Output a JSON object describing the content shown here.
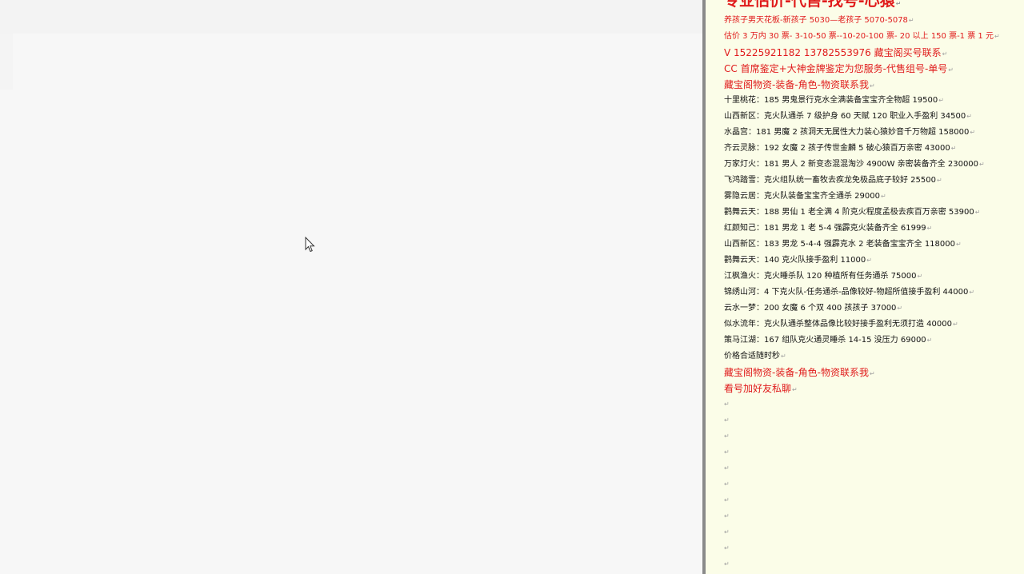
{
  "document": {
    "heading": "专业估价-代售-找号-心猿",
    "red_lines": [
      "养孩子男天花板-新孩子 5030—老孩子 5070-5078",
      "估价 3 万内 30 票- 3-10-50 票--10-20-100 票- 20 以上 150 票-1 票 1 元",
      "V 15225921182      13782553976      藏宝阁买号联系",
      "CC 首席鉴定+大神金牌鉴定为您服务-代售组号-单号",
      "藏宝阁物资-装备-角色-物资联系我"
    ],
    "listings": [
      "十里桃花：185 男鬼景行克水全满装备宝宝齐全物超 19500",
      "山西新区：克火队通杀 7 级护身 60 天赋 120 职业入手盈利 34500",
      "水晶宫：181 男魔 2 孩洞天无属性大力装心猿妙音千万物超 158000",
      "齐云灵脉：192 女魔 2 孩子传世金麟 5 破心猿百万亲密 43000",
      "万家灯火：181 男人 2 新变态混混淘沙 4900W 亲密装备齐全 230000",
      "飞鸿踏雪：克火组队统一畜牧去疾龙免极品底子较好 25500",
      "雾隐云居：克火队装备宝宝齐全通杀 29000",
      "鹳舞云天：188 男仙 1 老全满 4 阶克火程度孟极去疾百万亲密 53900",
      "红颜知己：181 男龙 1 老 5-4 强霹克火装备齐全 61999",
      "山西新区：183 男龙 5-4-4 强霹克水 2 老装备宝宝齐全 118000",
      "鹳舞云天：140 克火队接手盈利 11000",
      "江枫渔火：克火睡杀队 120 种植所有任务通杀 75000",
      "锦绣山河：4 下克火队-任务通杀-品像较好-物超所值接手盈利 44000",
      "云水一梦：200 女魔 6 个双 400 孩孩子 37000",
      "似水流年：克火队通杀整体品像比较好接手盈利无须打造 40000",
      "策马江湖：167 组队克火通灵睡杀 14-15 没压力 69000"
    ],
    "note": "价格合适随时秒",
    "footer_red": [
      "藏宝阁物资-装备-角色-物资联系我",
      "看号加好友私聊"
    ],
    "paragraph_mark": "↵",
    "empty_lines": 11
  },
  "watermark": "",
  "cursor": "arrow-cursor",
  "colors": {
    "page_background": "#fbfde8",
    "red_text": "#e01b1b",
    "black_text": "#111111",
    "left_pane": "#f7f7f7"
  }
}
